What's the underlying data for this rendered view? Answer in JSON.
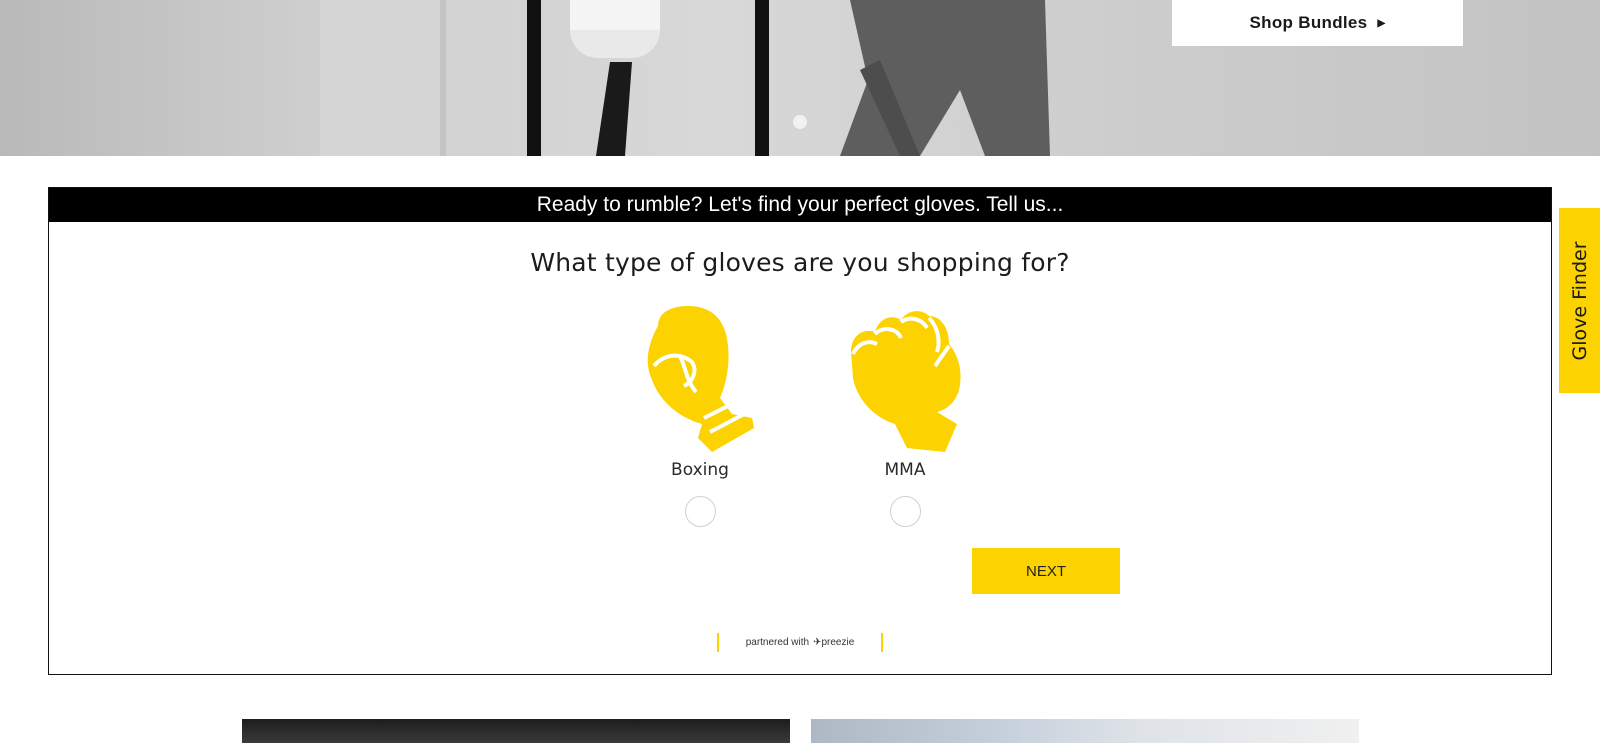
{
  "hero": {
    "shop_button_label": "Shop Bundles",
    "shop_button_icon": "triangle-right-icon",
    "carousel_dots": 1
  },
  "finder": {
    "header": "Ready to rumble? Let's find your perfect gloves. Tell us...",
    "question": "What type of gloves are you shopping for?",
    "options": [
      {
        "label": "Boxing",
        "icon": "boxing-glove-icon",
        "selected": false
      },
      {
        "label": "MMA",
        "icon": "mma-glove-icon",
        "selected": false
      }
    ],
    "next_label": "NEXT",
    "partner_text": "partnered with",
    "partner_brand": "preezie"
  },
  "side_tab": {
    "label": "Glove Finder"
  },
  "colors": {
    "accent": "#fcd200",
    "header_bg": "#000000"
  }
}
